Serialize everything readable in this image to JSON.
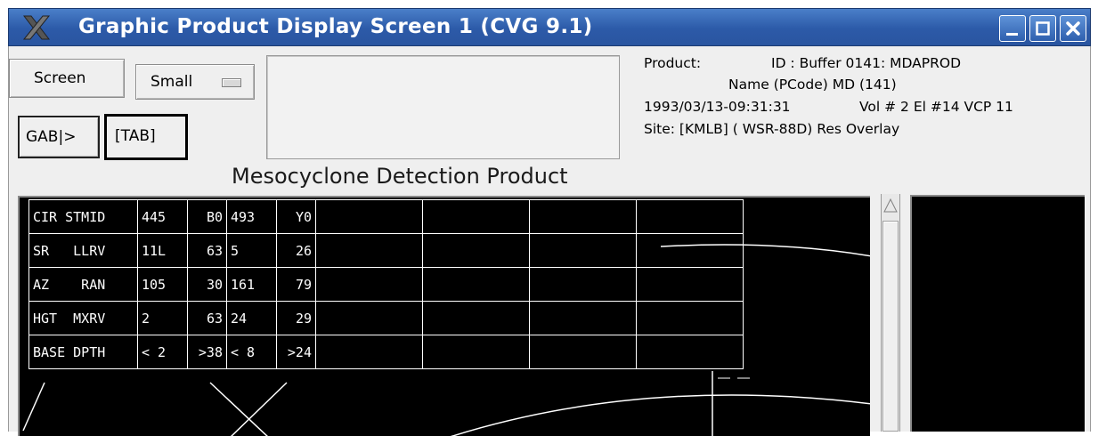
{
  "window": {
    "title": "Graphic Product Display Screen 1 (CVG 9.1)",
    "titlebar_color": "#2c5aa8",
    "buttons": [
      "minimize-icon",
      "maximize-icon",
      "close-icon"
    ]
  },
  "toolbar": {
    "screen_label": "Screen",
    "size_label": "Small",
    "gab_label": "GAB|>",
    "tab_label": "[TAB]"
  },
  "product_info": {
    "product_label": "Product:",
    "id_line": "ID : Buffer 0141: MDAPROD",
    "name_line": "Name (PCode)  MD  (141)",
    "datetime": "1993/03/13-09:31:31",
    "vol_el_vcp": "Vol # 2  El #14  VCP 11",
    "site_line": "Site: [KMLB] ( WSR-88D)  Res  Overlay"
  },
  "heading": "Mesocyclone Detection Product",
  "data_table": {
    "rows": [
      [
        "CIR STMID",
        "445",
        "B0",
        "493",
        "Y0",
        "",
        "",
        "",
        ""
      ],
      [
        "SR   LLRV",
        "11L",
        "63",
        "5",
        "26",
        "",
        "",
        "",
        ""
      ],
      [
        "AZ    RAN",
        "105",
        "30",
        "161",
        "79",
        "",
        "",
        "",
        ""
      ],
      [
        "HGT  MXRV",
        "2",
        "63",
        "24",
        "29",
        "",
        "",
        "",
        ""
      ],
      [
        "BASE DPTH",
        "< 2",
        ">38",
        "< 8",
        ">24",
        "",
        "",
        "",
        ""
      ]
    ]
  },
  "colors": {
    "display_bg": "#000000",
    "overlay_lines": "#ffffff",
    "panel_bg": "#efefef"
  }
}
